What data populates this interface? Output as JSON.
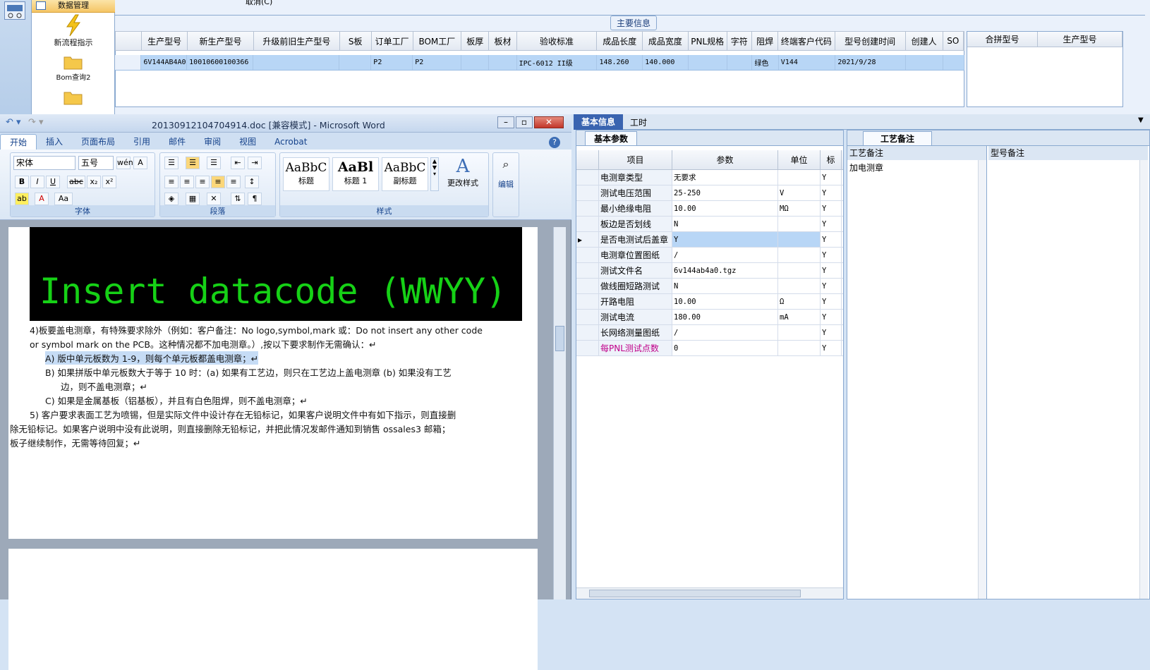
{
  "nav": {
    "tools": [
      {
        "label": "数据管理"
      },
      {
        "label": "新流程指示"
      },
      {
        "label": "Bom查询2"
      }
    ],
    "cancel_label": "取消(C)"
  },
  "top_grid": {
    "section_title": "主要信息",
    "columns": [
      "生产型号",
      "新生产型号",
      "升级前旧生产型号",
      "S板",
      "订单工厂",
      "BOM工厂",
      "板厚",
      "板材",
      "验收标准",
      "成品长度",
      "成品宽度",
      "PNL规格",
      "字符",
      "阻焊",
      "终端客户代码",
      "型号创建时间",
      "创建人",
      "SO"
    ],
    "row": [
      "6V144AB4A0",
      "10010600100366",
      "",
      "",
      "P2",
      "P2",
      "",
      "",
      "IPC-6012 II级",
      "148.260",
      "140.000",
      "",
      "",
      "绿色",
      "V144",
      "2021/9/28",
      "",
      ""
    ],
    "side_columns": [
      "合拼型号",
      "生产型号"
    ]
  },
  "word": {
    "title": "20130912104704914.doc [兼容模式] - Microsoft Word",
    "tabs": [
      "开始",
      "插入",
      "页面布局",
      "引用",
      "邮件",
      "审阅",
      "视图",
      "Acrobat"
    ],
    "font_name": "宋体",
    "font_size": "五号",
    "group_font": "字体",
    "group_paragraph": "段落",
    "group_styles": "样式",
    "styles": [
      {
        "preview": "AaBbC",
        "name": "标题"
      },
      {
        "preview": "AaBl",
        "name": "标题 1"
      },
      {
        "preview": "AaBbC",
        "name": "副标题"
      }
    ],
    "change_styles": "更改样式",
    "edit": "编辑",
    "banner_text": "Insert datacode (WWYY)",
    "lines": [
      "4)板要盖电测章，有特殊要求除外（例如：客户备注：No logo,symbol,mark 或：Do not insert any other code",
      "or symbol mark on the PCB。这种情况都不加电测章。）,按以下要求制作无需确认：↵",
      "A)  版中单元板数为 1-9，则每个单元板都盖电测章；↵",
      "B)  如果拼版中单元板数大于等于 10 时：(a) 如果有工艺边，则只在工艺边上盖电测章 (b) 如果没有工艺",
      "边，则不盖电测章；↵",
      "C)  如果是金属基板（铝基板），并且有白色阻焊，则不盖电测章；↵",
      "5) 客户要求表面工艺为喷锡，但是实际文件中设计存在无铅标记，如果客户说明文件中有如下指示，则直接删",
      "除无铅标记。如果客户说明中没有此说明，则直接删除无铅标记，并把此情况发邮件通知到销售 ossales3 邮箱；",
      "板子继续制作，无需等待回复；↵"
    ]
  },
  "right": {
    "tabs": [
      "基本信息",
      "工时"
    ],
    "basic_title": "基本参数",
    "basic_columns": [
      "项目",
      "参数",
      "单位",
      "标"
    ],
    "params": [
      {
        "item": "电测章类型",
        "value": "无要求",
        "unit": "",
        "flag": "Y"
      },
      {
        "item": "测试电压范围",
        "value": "25-250",
        "unit": "V",
        "flag": "Y"
      },
      {
        "item": "最小绝缘电阻",
        "value": "10.00",
        "unit": "MΩ",
        "flag": "Y"
      },
      {
        "item": "板边是否划线",
        "value": "N",
        "unit": "",
        "flag": "Y"
      },
      {
        "item": "是否电测试后盖章",
        "value": "Y",
        "unit": "",
        "flag": "Y"
      },
      {
        "item": "电测章位置图纸",
        "value": "/",
        "unit": "",
        "flag": "Y"
      },
      {
        "item": "测试文件名",
        "value": "6v144ab4a0.tgz",
        "unit": "",
        "flag": "Y"
      },
      {
        "item": "做线圈短路测试",
        "value": "N",
        "unit": "",
        "flag": "Y"
      },
      {
        "item": "开路电阻",
        "value": "10.00",
        "unit": "Ω",
        "flag": "Y"
      },
      {
        "item": "测试电流",
        "value": "180.00",
        "unit": "mA",
        "flag": "Y"
      },
      {
        "item": "长网络测量图纸",
        "value": "/",
        "unit": "",
        "flag": "Y"
      },
      {
        "item": "每PNL测试点数",
        "value": "0",
        "unit": "",
        "flag": "Y"
      }
    ],
    "craft_title": "工艺备注",
    "craft_columns": [
      "工艺备注",
      "型号备注"
    ],
    "craft_note": "加电测章",
    "colors": {
      "highlight": "#b8d6f6",
      "pink_item": "#c0008a"
    }
  }
}
